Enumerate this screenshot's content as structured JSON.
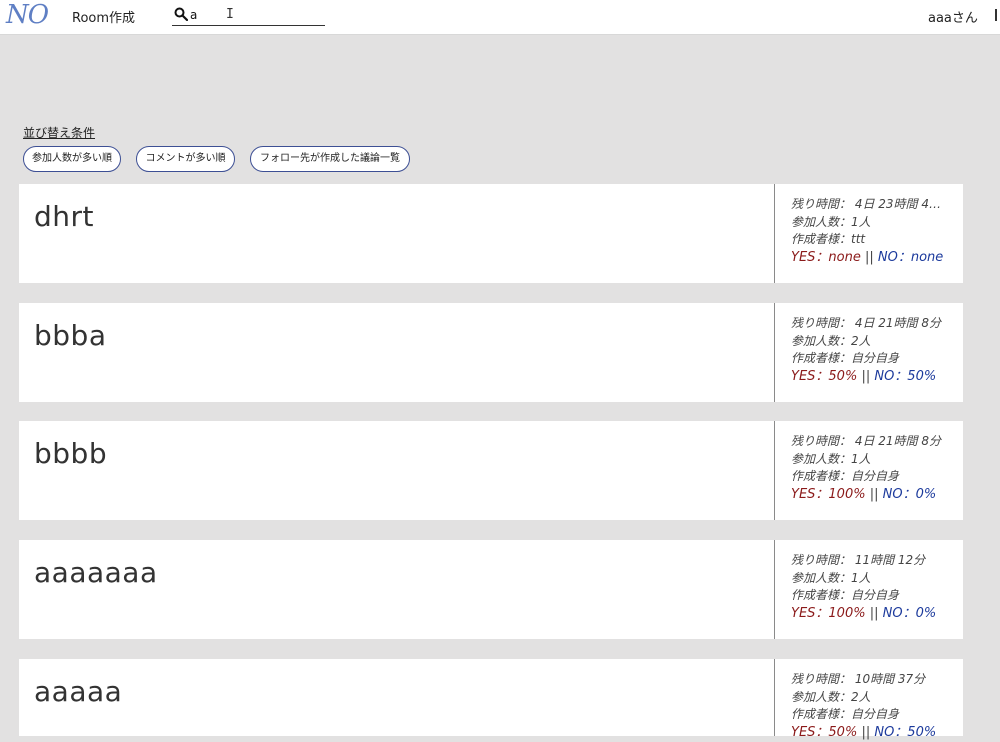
{
  "header": {
    "logo": "NO",
    "create_room": "Room作成",
    "search_value": "a",
    "username": "aaaさん"
  },
  "sort": {
    "title": "並び替え条件",
    "buttons": [
      "参加人数が多い順",
      "コメントが多い順",
      "フォロー先が作成した議論一覧"
    ]
  },
  "rooms": [
    {
      "title": "dhrt",
      "remaining": "残り時間： 4日 23時間 4…",
      "participants": "参加人数：1人",
      "creator": "作成者様：ttt",
      "yes": "YES：none",
      "sep": " || ",
      "no": "NO：none"
    },
    {
      "title": "bbba",
      "remaining": "残り時間： 4日 21時間 8分",
      "participants": "参加人数：2人",
      "creator": "作成者様：自分自身",
      "yes": "YES：50%",
      "sep": " || ",
      "no": "NO：50%"
    },
    {
      "title": "bbbb",
      "remaining": "残り時間： 4日 21時間 8分",
      "participants": "参加人数：1人",
      "creator": "作成者様：自分自身",
      "yes": "YES：100%",
      "sep": " || ",
      "no": "NO：0%"
    },
    {
      "title": "aaaaaaa",
      "remaining": "残り時間： 11時間 12分",
      "participants": "参加人数：1人",
      "creator": "作成者様：自分自身",
      "yes": "YES：100%",
      "sep": " || ",
      "no": "NO：0%"
    },
    {
      "title": "aaaaa",
      "remaining": "残り時間： 10時間 37分",
      "participants": "参加人数：2人",
      "creator": "作成者様：自分自身",
      "yes": "YES：50%",
      "sep": " || ",
      "no": "NO：50%"
    }
  ],
  "icons": {
    "search": "search-icon",
    "cursor": "text-cursor-icon"
  },
  "colors": {
    "yes": "#8b1a1a",
    "no": "#1c3a9c",
    "logo": "#5f7fc4",
    "sort_border": "#3d4f94"
  }
}
